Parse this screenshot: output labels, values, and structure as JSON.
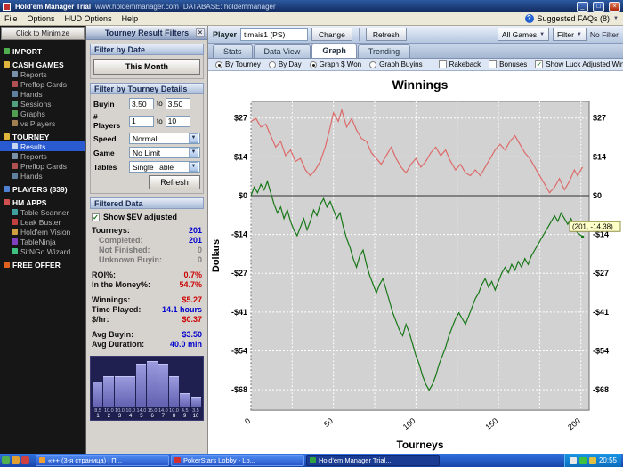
{
  "colors": {
    "accent_blue": "#2a5ad0",
    "value_blue": "#0000cc",
    "value_red": "#cc0000",
    "value_gray": "#808080",
    "line_red": "#dd6a6a",
    "line_green": "#187818",
    "bar_purple": "#8080cc"
  },
  "titlebar": {
    "app": "Hold'em Manager Trial",
    "site": "www.holdemmanager.com",
    "database": "DATABASE: holdemmanager"
  },
  "menubar": {
    "items": [
      "File",
      "Options",
      "HUD Options",
      "Help"
    ],
    "faq": "Suggested FAQs (8)"
  },
  "sidebar": {
    "minimize_label": "Click to Minimize",
    "tree": [
      {
        "label": "IMPORT",
        "type": "header",
        "icon": "import-icon"
      },
      {
        "label": "CASH GAMES",
        "type": "header",
        "icon": "folder-icon"
      },
      {
        "label": "Reports",
        "type": "item",
        "icon": "report-icon"
      },
      {
        "label": "Preflop Cards",
        "type": "item",
        "icon": "cards-icon"
      },
      {
        "label": "Hands",
        "type": "item",
        "icon": "hands-icon"
      },
      {
        "label": "Sessions",
        "type": "item",
        "icon": "sessions-icon"
      },
      {
        "label": "Graphs",
        "type": "item",
        "icon": "graphs-icon"
      },
      {
        "label": "vs Players",
        "type": "item",
        "icon": "vs-players-icon"
      },
      {
        "label": "TOURNEY",
        "type": "header",
        "icon": "folder-icon"
      },
      {
        "label": "Results",
        "type": "item",
        "icon": "results-icon",
        "selected": true
      },
      {
        "label": "Reports",
        "type": "item",
        "icon": "report-icon"
      },
      {
        "label": "Preflop Cards",
        "type": "item",
        "icon": "cards-icon"
      },
      {
        "label": "Hands",
        "type": "item",
        "icon": "hands-icon"
      },
      {
        "label": "PLAYERS (839)",
        "type": "header",
        "icon": "players-icon"
      },
      {
        "label": "HM APPS",
        "type": "header",
        "icon": "apps-icon"
      },
      {
        "label": "Table Scanner",
        "type": "item",
        "icon": "table-scanner-icon"
      },
      {
        "label": "Leak Buster",
        "type": "item",
        "icon": "leak-buster-icon"
      },
      {
        "label": "Hold'em Vision",
        "type": "item",
        "icon": "holdem-vision-icon"
      },
      {
        "label": "TableNinja",
        "type": "item",
        "icon": "tableninja-icon"
      },
      {
        "label": "SitNGo Wizard",
        "type": "item",
        "icon": "sitngo-wizard-icon"
      },
      {
        "label": "FREE OFFER",
        "type": "header",
        "icon": "free-offer-icon"
      }
    ]
  },
  "filters": {
    "panel_title": "Tourney Result Filters",
    "date_header": "Filter by Date",
    "date_button": "This Month",
    "details_header": "Filter by Tourney Details",
    "rows": [
      {
        "label": "Buyin",
        "from": "3.50",
        "mid": "to",
        "to": "3.50"
      },
      {
        "label": "# Players",
        "from": "1",
        "mid": "to",
        "to": "10"
      }
    ],
    "selects": [
      {
        "label": "Speed",
        "value": "Normal"
      },
      {
        "label": "Game",
        "value": "No Limit"
      },
      {
        "label": "Tables",
        "value": "Single Table"
      }
    ],
    "refresh_button": "Refresh",
    "data_header": "Filtered Data",
    "ev_checkbox_label": "Show $EV adjusted",
    "stats": [
      {
        "label": "Tourneys:",
        "value": "201",
        "color": "#0000cc",
        "indent": false,
        "dim": false,
        "gap": false
      },
      {
        "label": "Completed:",
        "value": "201",
        "color": "#0000cc",
        "indent": true,
        "dim": true,
        "gap": false
      },
      {
        "label": "Not Finished:",
        "value": "0",
        "color": "#808080",
        "indent": true,
        "dim": true,
        "gap": false
      },
      {
        "label": "Unknown Buyin:",
        "value": "0",
        "color": "#808080",
        "indent": true,
        "dim": true,
        "gap": false
      },
      {
        "label": "ROI%:",
        "value": "0.7%",
        "color": "#cc0000",
        "indent": false,
        "dim": false,
        "gap": true
      },
      {
        "label": "In the Money%:",
        "value": "54.7%",
        "color": "#cc0000",
        "indent": false,
        "dim": false,
        "gap": false
      },
      {
        "label": "Winnings:",
        "value": "$5.27",
        "color": "#cc0000",
        "indent": false,
        "dim": false,
        "gap": true
      },
      {
        "label": "Time Played:",
        "value": "14.1 hours",
        "color": "#0000cc",
        "indent": false,
        "dim": false,
        "gap": false
      },
      {
        "label": "$/hr:",
        "value": "$0.37",
        "color": "#cc0000",
        "indent": false,
        "dim": false,
        "gap": false
      },
      {
        "label": "Avg Buyin:",
        "value": "$3.50",
        "color": "#0000cc",
        "indent": false,
        "dim": false,
        "gap": true
      },
      {
        "label": "Avg Duration:",
        "value": "40.0 min",
        "color": "#0000cc",
        "indent": false,
        "dim": false,
        "gap": false
      }
    ],
    "histogram": {
      "values": [
        8.5,
        10.0,
        10.0,
        10.0,
        14.0,
        15.0,
        14.0,
        10.0,
        4.5,
        3.5
      ],
      "value_labels": [
        "8.5",
        "10.0",
        "10.0",
        "10.0",
        "14.0",
        "15.0",
        "14.0",
        "10.0",
        "4.5",
        "3.5"
      ],
      "position_labels": [
        "1",
        "2",
        "3",
        "4",
        "5",
        "6",
        "7",
        "8",
        "9",
        "10"
      ]
    }
  },
  "toolbar": {
    "player_label": "Player",
    "player_value": "timais1 (PS)",
    "change_button": "Change",
    "refresh_button": "Refresh",
    "all_games": "All Games",
    "filter_button": "Filter",
    "no_filter": "No Filter"
  },
  "tabs": [
    {
      "label": "Stats",
      "active": false
    },
    {
      "label": "Data View",
      "active": false
    },
    {
      "label": "Graph",
      "active": true
    },
    {
      "label": "Trending",
      "active": false
    }
  ],
  "graph_controls": {
    "radios": [
      {
        "label": "By Tourney",
        "selected": true
      },
      {
        "label": "By Day",
        "selected": false
      },
      {
        "label": "Graph $ Won",
        "selected": true
      },
      {
        "label": "Graph Buyins",
        "selected": false
      }
    ],
    "checkboxes": [
      {
        "label": "Rakeback",
        "checked": false
      },
      {
        "label": "Bonuses",
        "checked": false
      },
      {
        "label": "Show Luck Adjusted Winnings",
        "checked": true
      }
    ]
  },
  "chart_data": {
    "type": "line",
    "title": "Winnings",
    "xlabel": "Tourneys",
    "ylabel": "Dollars",
    "x_range": [
      0,
      205
    ],
    "y_range": [
      -75,
      33
    ],
    "x_gridlines_every": 25,
    "x_tick_labels": [
      {
        "x": 0,
        "label": "0"
      },
      {
        "x": 50,
        "label": "50"
      },
      {
        "x": 100,
        "label": "100"
      },
      {
        "x": 150,
        "label": "150"
      },
      {
        "x": 200,
        "label": "200"
      }
    ],
    "y_ticks": [
      {
        "v": 27.14,
        "label": "$27"
      },
      {
        "v": 13.57,
        "label": "$14"
      },
      {
        "v": 0,
        "label": "$0"
      },
      {
        "v": -13.57,
        "label": "-$14"
      },
      {
        "v": -27.14,
        "label": "-$27"
      },
      {
        "v": -40.71,
        "label": "-$41"
      },
      {
        "v": -54.29,
        "label": "-$54"
      },
      {
        "v": -67.86,
        "label": "-$68"
      }
    ],
    "tooltip": "(201, -14.38)",
    "series": [
      {
        "name": "Luck Adjusted Winnings",
        "color": "#dd6a6a",
        "points": [
          [
            0,
            26
          ],
          [
            3,
            27
          ],
          [
            6,
            24
          ],
          [
            9,
            25
          ],
          [
            12,
            21
          ],
          [
            15,
            17
          ],
          [
            18,
            19
          ],
          [
            21,
            14
          ],
          [
            24,
            16
          ],
          [
            27,
            12
          ],
          [
            30,
            13
          ],
          [
            33,
            9
          ],
          [
            36,
            7
          ],
          [
            39,
            9
          ],
          [
            42,
            12
          ],
          [
            45,
            17
          ],
          [
            48,
            24
          ],
          [
            50,
            29
          ],
          [
            53,
            26
          ],
          [
            55,
            30
          ],
          [
            58,
            24
          ],
          [
            61,
            27
          ],
          [
            64,
            23
          ],
          [
            67,
            20
          ],
          [
            70,
            19
          ],
          [
            73,
            15
          ],
          [
            76,
            13
          ],
          [
            79,
            11
          ],
          [
            82,
            14
          ],
          [
            85,
            17
          ],
          [
            88,
            13
          ],
          [
            91,
            10
          ],
          [
            94,
            8
          ],
          [
            97,
            11
          ],
          [
            100,
            13
          ],
          [
            103,
            10
          ],
          [
            106,
            12
          ],
          [
            109,
            15
          ],
          [
            112,
            17
          ],
          [
            115,
            14
          ],
          [
            118,
            16
          ],
          [
            121,
            12
          ],
          [
            124,
            9
          ],
          [
            127,
            11
          ],
          [
            130,
            8
          ],
          [
            133,
            7
          ],
          [
            136,
            9
          ],
          [
            139,
            7
          ],
          [
            142,
            10
          ],
          [
            145,
            13
          ],
          [
            148,
            16
          ],
          [
            151,
            18
          ],
          [
            154,
            16
          ],
          [
            157,
            19
          ],
          [
            160,
            21
          ],
          [
            163,
            18
          ],
          [
            166,
            15
          ],
          [
            169,
            13
          ],
          [
            172,
            10
          ],
          [
            175,
            7
          ],
          [
            178,
            4
          ],
          [
            181,
            1
          ],
          [
            184,
            3
          ],
          [
            187,
            6
          ],
          [
            190,
            2
          ],
          [
            193,
            5
          ],
          [
            196,
            9
          ],
          [
            198,
            7
          ],
          [
            201,
            10
          ]
        ]
      },
      {
        "name": "Winnings",
        "color": "#187818",
        "points": [
          [
            0,
            0
          ],
          [
            2,
            3
          ],
          [
            4,
            1
          ],
          [
            6,
            4
          ],
          [
            8,
            2
          ],
          [
            10,
            5
          ],
          [
            12,
            1
          ],
          [
            14,
            -3
          ],
          [
            16,
            -6
          ],
          [
            18,
            -4
          ],
          [
            20,
            -8
          ],
          [
            22,
            -5
          ],
          [
            24,
            -9
          ],
          [
            26,
            -12
          ],
          [
            28,
            -14
          ],
          [
            30,
            -11
          ],
          [
            32,
            -8
          ],
          [
            34,
            -12
          ],
          [
            36,
            -9
          ],
          [
            38,
            -5
          ],
          [
            40,
            -7
          ],
          [
            42,
            -3
          ],
          [
            44,
            -1
          ],
          [
            46,
            -4
          ],
          [
            48,
            -2
          ],
          [
            50,
            -5
          ],
          [
            52,
            -8
          ],
          [
            54,
            -6
          ],
          [
            56,
            -11
          ],
          [
            58,
            -15
          ],
          [
            60,
            -18
          ],
          [
            62,
            -22
          ],
          [
            64,
            -25
          ],
          [
            66,
            -21
          ],
          [
            68,
            -19
          ],
          [
            70,
            -24
          ],
          [
            72,
            -28
          ],
          [
            74,
            -31
          ],
          [
            76,
            -34
          ],
          [
            78,
            -31
          ],
          [
            80,
            -29
          ],
          [
            82,
            -33
          ],
          [
            84,
            -37
          ],
          [
            86,
            -41
          ],
          [
            88,
            -44
          ],
          [
            90,
            -47
          ],
          [
            92,
            -49
          ],
          [
            94,
            -45
          ],
          [
            96,
            -48
          ],
          [
            98,
            -52
          ],
          [
            100,
            -56
          ],
          [
            102,
            -59
          ],
          [
            104,
            -63
          ],
          [
            106,
            -66
          ],
          [
            108,
            -68
          ],
          [
            110,
            -66
          ],
          [
            112,
            -63
          ],
          [
            114,
            -59
          ],
          [
            116,
            -56
          ],
          [
            118,
            -53
          ],
          [
            120,
            -49
          ],
          [
            122,
            -46
          ],
          [
            124,
            -43
          ],
          [
            126,
            -41
          ],
          [
            128,
            -43
          ],
          [
            130,
            -45
          ],
          [
            132,
            -42
          ],
          [
            134,
            -39
          ],
          [
            136,
            -36
          ],
          [
            138,
            -34
          ],
          [
            140,
            -31
          ],
          [
            142,
            -29
          ],
          [
            144,
            -32
          ],
          [
            146,
            -30
          ],
          [
            148,
            -33
          ],
          [
            150,
            -30
          ],
          [
            152,
            -27
          ],
          [
            154,
            -25
          ],
          [
            156,
            -27
          ],
          [
            158,
            -24
          ],
          [
            160,
            -26
          ],
          [
            162,
            -23
          ],
          [
            164,
            -25
          ],
          [
            166,
            -22
          ],
          [
            168,
            -24
          ],
          [
            170,
            -21
          ],
          [
            172,
            -19
          ],
          [
            174,
            -17
          ],
          [
            176,
            -15
          ],
          [
            178,
            -13
          ],
          [
            180,
            -11
          ],
          [
            182,
            -9
          ],
          [
            184,
            -7
          ],
          [
            186,
            -9
          ],
          [
            188,
            -6
          ],
          [
            190,
            -8
          ],
          [
            192,
            -10
          ],
          [
            194,
            -8
          ],
          [
            196,
            -11
          ],
          [
            198,
            -13
          ],
          [
            201,
            -14.38
          ]
        ]
      }
    ]
  },
  "taskbar": {
    "buttons": [
      {
        "label": "«++ (3-я страница) | П...",
        "active": false,
        "icon": "document-icon"
      },
      {
        "label": "PokerStars Lobby - Lo...",
        "active": false,
        "icon": "pokerstars-icon"
      },
      {
        "label": "Hold'em Manager Trial...",
        "active": true,
        "icon": "holdem-manager-icon"
      }
    ],
    "clock": "20:55"
  }
}
